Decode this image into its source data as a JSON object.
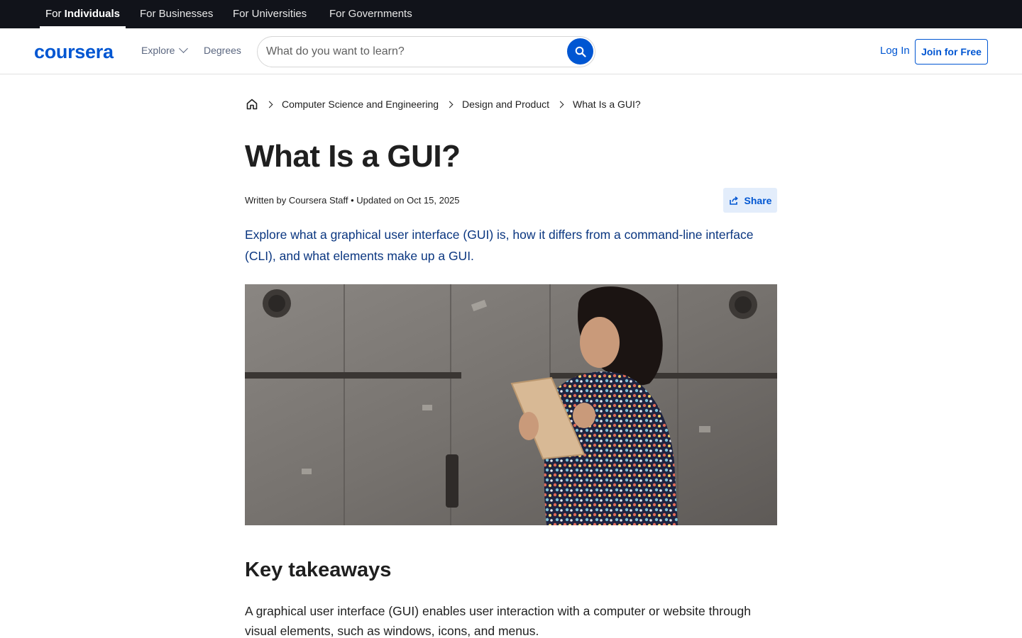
{
  "topbar": {
    "audiences": [
      {
        "prefix": "For ",
        "bold": "Individuals"
      },
      {
        "label": "For Businesses"
      },
      {
        "label": "For Universities"
      },
      {
        "label": "For Governments"
      }
    ]
  },
  "header": {
    "logo_text": "coursera",
    "explore_label": "Explore",
    "degrees_label": "Degrees",
    "search_placeholder": "What do you want to learn?",
    "login_label": "Log In",
    "join_label": "Join for Free"
  },
  "breadcrumb": {
    "items": [
      "Computer Science and Engineering",
      "Design and Product",
      "What Is a GUI?"
    ]
  },
  "article": {
    "title": "What Is a GUI?",
    "byline": "Written by Coursera Staff • Updated on Oct 15, 2025",
    "share_label": "Share",
    "summary": "Explore what a graphical user interface (GUI) is, how it differs from a command-line interface (CLI), and what elements make up a GUI.",
    "section_title": "Key takeaways",
    "paragraph": "A graphical user interface (GUI) enables user interaction with a computer or website through visual elements, such as windows, icons, and menus."
  },
  "colors": {
    "brand": "#0056d2",
    "topbar_bg": "#11131a",
    "summary_text": "#0a3680",
    "share_bg": "#e3edfb"
  },
  "icons": [
    "search-icon",
    "home-icon",
    "chevron-right-icon",
    "chevron-down-icon",
    "share-icon"
  ]
}
